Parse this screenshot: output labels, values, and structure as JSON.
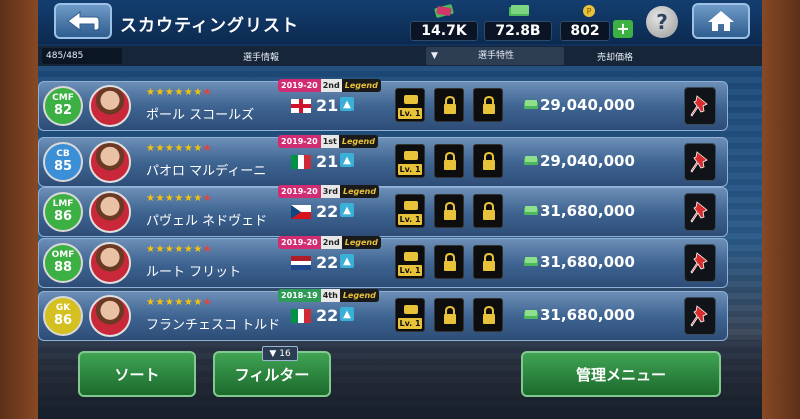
{
  "header": {
    "title": "スカウティングリスト",
    "gp_value": "14.7K",
    "coins_value": "72.8B",
    "points_value": "802",
    "plus_label": "+",
    "help_label": "?"
  },
  "columns": {
    "count": "485/485",
    "player_info": "選手情報",
    "traits": "選手特性",
    "sale_price": "売却価格"
  },
  "rows": [
    {
      "position": "CMF",
      "rating": "82",
      "position_color": "#3cb043",
      "name": "ポール スコールズ",
      "stars_gold": "★★★★★★",
      "stars_red": "★",
      "season": "2019-20",
      "rank": "2nd",
      "legend": "Legend",
      "tag_color": "pink",
      "flag": "england",
      "age": "21",
      "level": "Lv. 1",
      "price": "29,040,000"
    },
    {
      "position": "CB",
      "rating": "85",
      "position_color": "#3a8fd6",
      "name": "パオロ マルディーニ",
      "stars_gold": "★★★★★★",
      "stars_red": "★",
      "season": "2019-20",
      "rank": "1st",
      "legend": "Legend",
      "tag_color": "pink",
      "flag": "italy",
      "age": "21",
      "level": "Lv. 1",
      "price": "29,040,000"
    },
    {
      "position": "LMF",
      "rating": "86",
      "position_color": "#3cb043",
      "name": "パヴェル ネドヴェド",
      "stars_gold": "★★★★★★",
      "stars_red": "★",
      "season": "2019-20",
      "rank": "3rd",
      "legend": "Legend",
      "tag_color": "pink",
      "flag": "czech",
      "age": "22",
      "level": "Lv. 1",
      "price": "31,680,000"
    },
    {
      "position": "OMF",
      "rating": "88",
      "position_color": "#3cb043",
      "name": "ルート フリット",
      "stars_gold": "★★★★★★",
      "stars_red": "★",
      "season": "2019-20",
      "rank": "2nd",
      "legend": "Legend",
      "tag_color": "pink",
      "flag": "netherlands",
      "age": "22",
      "level": "Lv. 1",
      "price": "31,680,000"
    },
    {
      "position": "GK",
      "rating": "86",
      "position_color": "#d4c020",
      "name": "フランチェスコ トルド",
      "stars_gold": "★★★★★★",
      "stars_red": "★",
      "season": "2018-19",
      "rank": "4th",
      "legend": "Legend",
      "tag_color": "green",
      "flag": "italy",
      "age": "22",
      "level": "Lv. 1",
      "price": "31,680,000"
    }
  ],
  "bottom": {
    "sort_label": "ソート",
    "filter_label": "フィルター",
    "filter_count": "16",
    "manage_label": "管理メニュー"
  }
}
